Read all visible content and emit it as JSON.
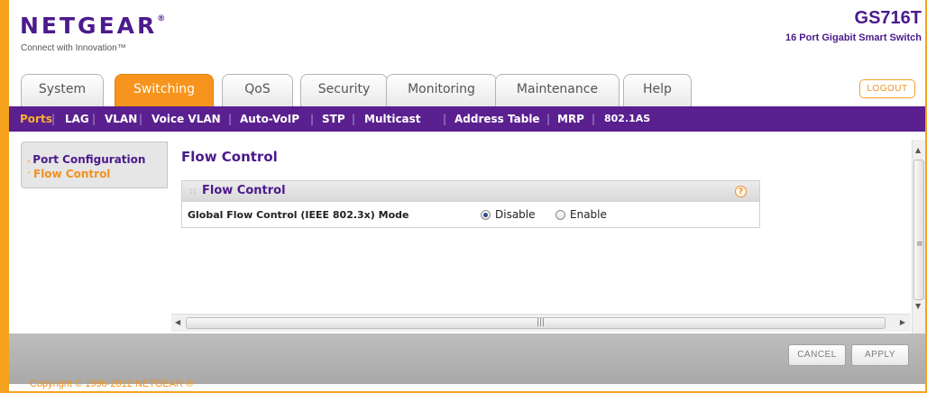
{
  "header": {
    "logo_text": "NETGEAR",
    "logo_mark": "®",
    "tagline": "Connect with Innovation™",
    "model": "GS716T",
    "model_desc": "16 Port Gigabit Smart Switch"
  },
  "main_tabs": [
    {
      "label": "System",
      "active": false
    },
    {
      "label": "Switching",
      "active": true
    },
    {
      "label": "QoS",
      "active": false
    },
    {
      "label": "Security",
      "active": false
    },
    {
      "label": "Monitoring",
      "active": false
    },
    {
      "label": "Maintenance",
      "active": false
    },
    {
      "label": "Help",
      "active": false
    }
  ],
  "logout_label": "LOGOUT",
  "sub_nav": [
    {
      "label": "Ports",
      "active": true
    },
    {
      "label": "LAG",
      "active": false
    },
    {
      "label": "VLAN",
      "active": false
    },
    {
      "label": "Voice VLAN",
      "active": false
    },
    {
      "label": "Auto-VoIP",
      "active": false
    },
    {
      "label": "STP",
      "active": false
    },
    {
      "label": "Multicast",
      "active": false
    },
    {
      "label": "Address Table",
      "active": false
    },
    {
      "label": "MRP",
      "active": false
    },
    {
      "label": "802.1AS",
      "active": false
    }
  ],
  "left_nav": [
    {
      "label": "Port Configuration",
      "marker": "›",
      "active": false
    },
    {
      "label": "Flow Control",
      "marker": "˅",
      "active": true
    }
  ],
  "page_title": "Flow Control",
  "panel": {
    "title": "Flow Control",
    "help_glyph": "?",
    "field_label": "Global Flow Control (IEEE 802.3x) Mode",
    "options": [
      {
        "label": "Disable",
        "checked": true
      },
      {
        "label": "Enable",
        "checked": false
      }
    ]
  },
  "buttons": {
    "cancel": "CANCEL",
    "apply": "APPLY"
  },
  "copyright": "Copyright © 1996-2012 NETGEAR ®",
  "colors": {
    "brand_purple": "#4b1a8c",
    "accent_orange": "#f7941d",
    "subnav_bg": "#5a208f"
  }
}
